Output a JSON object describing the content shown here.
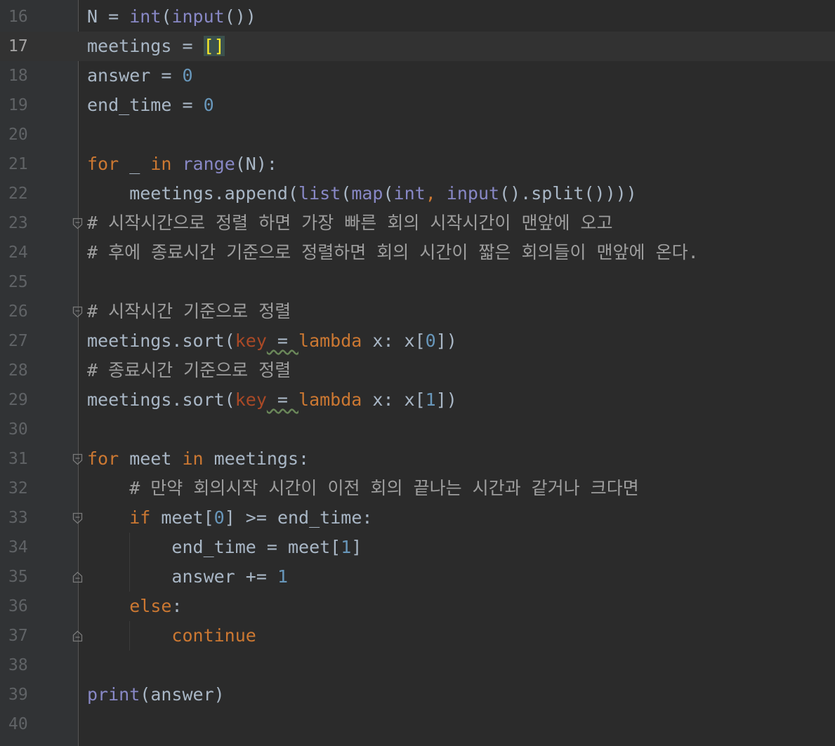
{
  "editor": {
    "current_line": 17,
    "lines": [
      {
        "n": "16",
        "tokens": [
          {
            "t": "N = ",
            "c": "plain"
          },
          {
            "t": "int",
            "c": "builtin"
          },
          {
            "t": "(",
            "c": "plain"
          },
          {
            "t": "input",
            "c": "builtin"
          },
          {
            "t": "())",
            "c": "plain"
          }
        ]
      },
      {
        "n": "17",
        "tokens": [
          {
            "t": "meetings = ",
            "c": "plain"
          },
          {
            "t": "[]",
            "c": "bracket-hl"
          }
        ]
      },
      {
        "n": "18",
        "tokens": [
          {
            "t": "answer = ",
            "c": "plain"
          },
          {
            "t": "0",
            "c": "num"
          }
        ]
      },
      {
        "n": "19",
        "tokens": [
          {
            "t": "end_time = ",
            "c": "plain"
          },
          {
            "t": "0",
            "c": "num"
          }
        ]
      },
      {
        "n": "20",
        "tokens": []
      },
      {
        "n": "21",
        "tokens": [
          {
            "t": "for",
            "c": "kw"
          },
          {
            "t": " _ ",
            "c": "plain"
          },
          {
            "t": "in",
            "c": "kw"
          },
          {
            "t": " ",
            "c": "plain"
          },
          {
            "t": "range",
            "c": "builtin"
          },
          {
            "t": "(N):",
            "c": "plain"
          }
        ]
      },
      {
        "n": "22",
        "tokens": [
          {
            "t": "    meetings.append(",
            "c": "plain"
          },
          {
            "t": "list",
            "c": "builtin"
          },
          {
            "t": "(",
            "c": "plain"
          },
          {
            "t": "map",
            "c": "builtin"
          },
          {
            "t": "(",
            "c": "plain"
          },
          {
            "t": "int",
            "c": "builtin"
          },
          {
            "t": ", ",
            "c": "kw"
          },
          {
            "t": "input",
            "c": "builtin"
          },
          {
            "t": "().split())))",
            "c": "plain"
          }
        ]
      },
      {
        "n": "23",
        "fold": "open",
        "tokens": [
          {
            "t": "# 시작시간으로 정렬 하면 가장 빠른 회의 시작시간이 맨앞에 오고",
            "c": "comment"
          }
        ]
      },
      {
        "n": "24",
        "tokens": [
          {
            "t": "# 후에 종료시간 기준으로 정렬하면 회의 시간이 짧은 회의들이 맨앞에 온다.",
            "c": "comment"
          }
        ]
      },
      {
        "n": "25",
        "tokens": []
      },
      {
        "n": "26",
        "fold": "open",
        "tokens": [
          {
            "t": "# 시작시간 기준으로 정렬",
            "c": "comment"
          }
        ]
      },
      {
        "n": "27",
        "tokens": [
          {
            "t": "meetings.sort(",
            "c": "plain"
          },
          {
            "t": "key",
            "c": "param"
          },
          {
            "t": " = ",
            "c": "plain",
            "squig": true
          },
          {
            "t": "lambda",
            "c": "kw"
          },
          {
            "t": " x: x[",
            "c": "plain"
          },
          {
            "t": "0",
            "c": "num"
          },
          {
            "t": "])",
            "c": "plain"
          }
        ]
      },
      {
        "n": "28",
        "tokens": [
          {
            "t": "# 종료시간 기준으로 정렬",
            "c": "comment"
          }
        ]
      },
      {
        "n": "29",
        "tokens": [
          {
            "t": "meetings.sort(",
            "c": "plain"
          },
          {
            "t": "key",
            "c": "param"
          },
          {
            "t": " = ",
            "c": "plain",
            "squig": true
          },
          {
            "t": "lambda",
            "c": "kw"
          },
          {
            "t": " x: x[",
            "c": "plain"
          },
          {
            "t": "1",
            "c": "num"
          },
          {
            "t": "])",
            "c": "plain"
          }
        ]
      },
      {
        "n": "30",
        "tokens": []
      },
      {
        "n": "31",
        "fold": "open",
        "tokens": [
          {
            "t": "for",
            "c": "kw"
          },
          {
            "t": " meet ",
            "c": "plain"
          },
          {
            "t": "in",
            "c": "kw"
          },
          {
            "t": " meetings:",
            "c": "plain"
          }
        ]
      },
      {
        "n": "32",
        "tokens": [
          {
            "t": "    # 만약 회의시작 시간이 이전 회의 끝나는 시간과 같거나 크다면",
            "c": "comment"
          }
        ]
      },
      {
        "n": "33",
        "fold": "open",
        "tokens": [
          {
            "t": "    ",
            "c": "plain"
          },
          {
            "t": "if",
            "c": "kw"
          },
          {
            "t": " meet[",
            "c": "plain"
          },
          {
            "t": "0",
            "c": "num"
          },
          {
            "t": "] >= end_time:",
            "c": "plain"
          }
        ]
      },
      {
        "n": "34",
        "tokens": [
          {
            "t": "        end_time = meet[",
            "c": "plain"
          },
          {
            "t": "1",
            "c": "num"
          },
          {
            "t": "]",
            "c": "plain"
          }
        ]
      },
      {
        "n": "35",
        "fold": "close",
        "tokens": [
          {
            "t": "        answer += ",
            "c": "plain"
          },
          {
            "t": "1",
            "c": "num"
          }
        ]
      },
      {
        "n": "36",
        "tokens": [
          {
            "t": "    ",
            "c": "plain"
          },
          {
            "t": "else",
            "c": "kw"
          },
          {
            "t": ":",
            "c": "plain"
          }
        ]
      },
      {
        "n": "37",
        "fold": "close",
        "tokens": [
          {
            "t": "        ",
            "c": "plain"
          },
          {
            "t": "continue",
            "c": "kw"
          }
        ]
      },
      {
        "n": "38",
        "tokens": []
      },
      {
        "n": "39",
        "tokens": [
          {
            "t": "print",
            "c": "builtin"
          },
          {
            "t": "(answer)",
            "c": "plain"
          }
        ]
      },
      {
        "n": "40",
        "tokens": []
      }
    ]
  }
}
